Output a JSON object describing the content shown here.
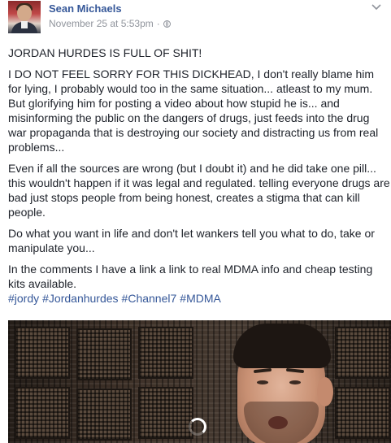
{
  "post": {
    "author": "Sean Michaels",
    "timestamp": "November 25 at 5:53pm",
    "separator": "·",
    "privacy_icon": "globe-icon",
    "menu_icon": "chevron-down-icon",
    "paragraphs": [
      "JORDAN HURDES IS FULL OF SHIT!",
      "I DO NOT FEEL SORRY FOR THIS DICKHEAD, I don't really blame him for lying, I probably would too in the same situation... atleast to my mum. But glorifying him for posting a video about how stupid he is... and misinforming the public on the dangers of drugs, just feeds into the drug war propaganda that is destroying our society and distracting us from real problems...",
      "Even if all the sources are wrong (but I doubt it) and he did take one pill... this wouldn't happen if it was legal and regulated. telling everyone drugs are bad just stops people from being honest, creates a stigma that can kill people.",
      "Do what you want in life and don't let wankers tell you what to do, take or manipulate you...",
      "In the comments I have a link a link to real MDMA info and cheap testing kits available."
    ],
    "hashtags": [
      "#jordy",
      "#Jordanhurdes",
      "#Channel7",
      "#MDMA"
    ],
    "video": {
      "state": "loading",
      "spinner_icon": "loading-spinner-icon"
    }
  },
  "colors": {
    "link": "#365899",
    "meta": "#90949c",
    "text": "#1d2129"
  }
}
